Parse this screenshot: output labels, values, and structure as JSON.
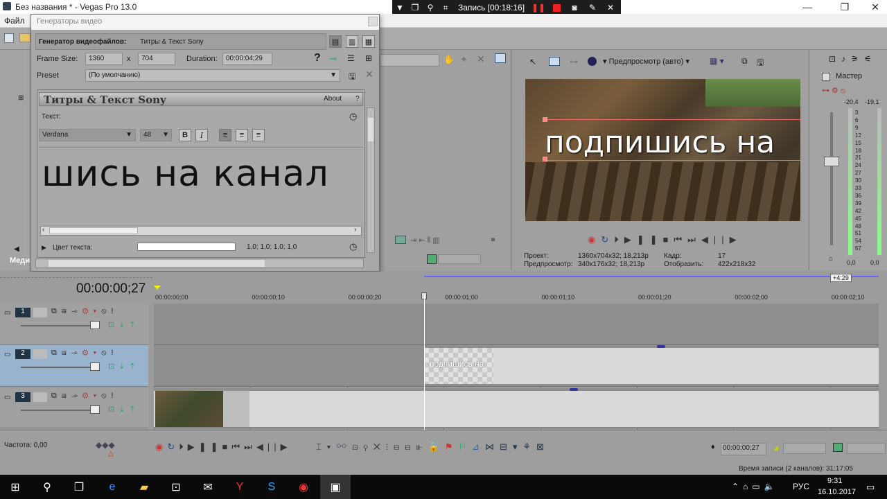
{
  "window": {
    "title": "Без названия * - Vegas Pro 13.0",
    "min": "—",
    "max": "❐",
    "close": "✕"
  },
  "menu": {
    "file": "Файл"
  },
  "recorder": {
    "label": "Запись [00:18:16]"
  },
  "left_dock": {
    "tab": "Медиа"
  },
  "gen": {
    "header": "Генераторы видео",
    "gen_label": "Генератор видеофайлов:",
    "gen_name": "Титры & Текст Sony",
    "frame_size_label": "Frame Size:",
    "frame_w": "1360",
    "frame_x": "x",
    "frame_h": "704",
    "duration_label": "Duration:",
    "duration": "00:00:04;29",
    "preset_label": "Preset",
    "preset_value": "(По умолчанию)",
    "panel_title": "Титры & Текст Sony",
    "about": "About",
    "help": "?",
    "text_label": "Текст:",
    "font": "Verdana",
    "size": "48",
    "bold": "B",
    "italic": "I",
    "big_text": "шись на канал",
    "color_label": "Цвет текста:",
    "color_value": "1,0; 1,0; 1,0; 1,0"
  },
  "preview": {
    "mode": "Предпросмотр (авто)",
    "overlay_text": "подпишись на",
    "project_label": "Проект:",
    "project_value": "1360x704x32; 18,213p",
    "preview_label": "Предпросмотр:",
    "preview_value": "340x176x32; 18,213p",
    "frame_label": "Кадр:",
    "frame_value": "17",
    "display_label": "Отобразить:",
    "display_value": "422x218x32"
  },
  "master": {
    "label": "Мастер",
    "left_db": "-20,4",
    "right_db": "-19,1",
    "scale": [
      "3",
      "6",
      "9",
      "12",
      "15",
      "18",
      "21",
      "24",
      "27",
      "30",
      "33",
      "36",
      "39",
      "42",
      "45",
      "48",
      "51",
      "54",
      "57"
    ],
    "bottom_left": "0,0",
    "bottom_right": "0,0"
  },
  "timeline": {
    "timecode": "00:00:00;27",
    "ruler": [
      "00:00:00;00",
      "00:00:00;10",
      "00:00:00;20",
      "00:00:01;00",
      "00:00:01;10",
      "00:00:01;20",
      "00:00:02;00",
      "00:00:02;10"
    ],
    "end_badge": "+4:29",
    "tracks": [
      {
        "num": "1"
      },
      {
        "num": "2"
      },
      {
        "num": "3"
      }
    ],
    "clip_text": "подпишись на"
  },
  "bottom": {
    "rate": "Частота: 0,00",
    "time": "00:00:00;27",
    "rec_time": "Время записи (2 каналов): 31:17:05"
  },
  "taskbar": {
    "lang": "РУС",
    "time": "9:31",
    "date": "16.10.2017"
  }
}
